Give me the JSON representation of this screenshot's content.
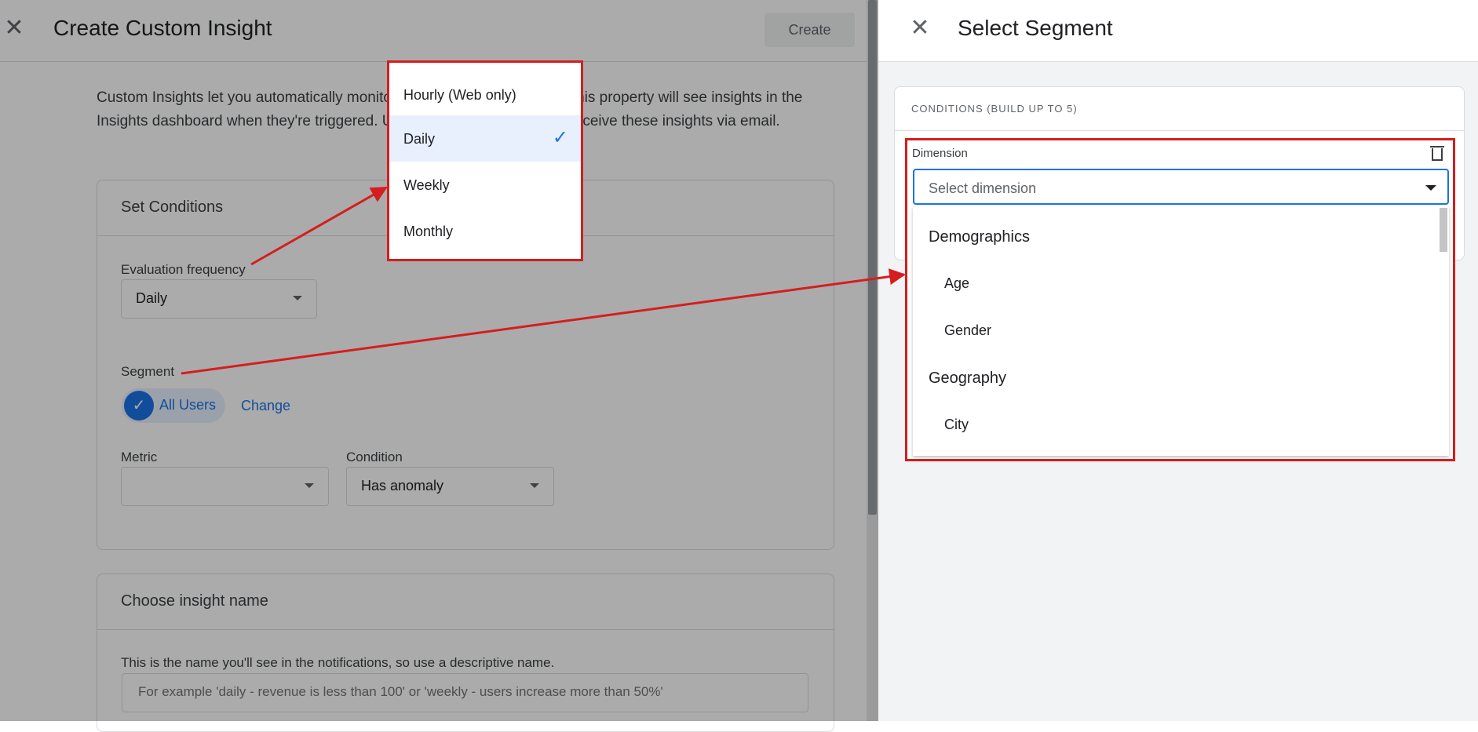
{
  "left": {
    "title": "Create Custom Insight",
    "create_label": "Create",
    "intro": "Custom Insights let you automatically monitor your property. All users in this property will see insights in the Insights dashboard when they're triggered. Users can also subscribe to receive these insights via email.",
    "set_conditions": {
      "heading": "Set Conditions",
      "evaluation_frequency_label": "Evaluation frequency",
      "evaluation_frequency_value": "Daily",
      "segment_label": "Segment",
      "segment_chip": "All Users",
      "change_link": "Change",
      "metric_label": "Metric",
      "metric_value": "",
      "condition_label": "Condition",
      "condition_value": "Has anomaly"
    },
    "insight_name": {
      "heading": "Choose insight name",
      "description": "This is the name you'll see in the notifications, so use a descriptive name.",
      "placeholder": "For example 'daily - revenue is less than 100' or 'weekly - users increase more than 50%'"
    }
  },
  "frequency_menu": {
    "options": [
      "Hourly (Web only)",
      "Daily",
      "Weekly",
      "Monthly"
    ],
    "selected": "Daily"
  },
  "right": {
    "title": "Select Segment",
    "conditions_heading": "CONDITIONS (BUILD UP TO 5)",
    "dimension_label": "Dimension",
    "dimension_placeholder": "Select dimension",
    "groups": [
      {
        "name": "Demographics",
        "items": [
          "Age",
          "Gender"
        ]
      },
      {
        "name": "Geography",
        "items": [
          "City"
        ]
      }
    ]
  },
  "colors": {
    "accent": "#1a73e8",
    "annotation": "#d61d1d"
  }
}
